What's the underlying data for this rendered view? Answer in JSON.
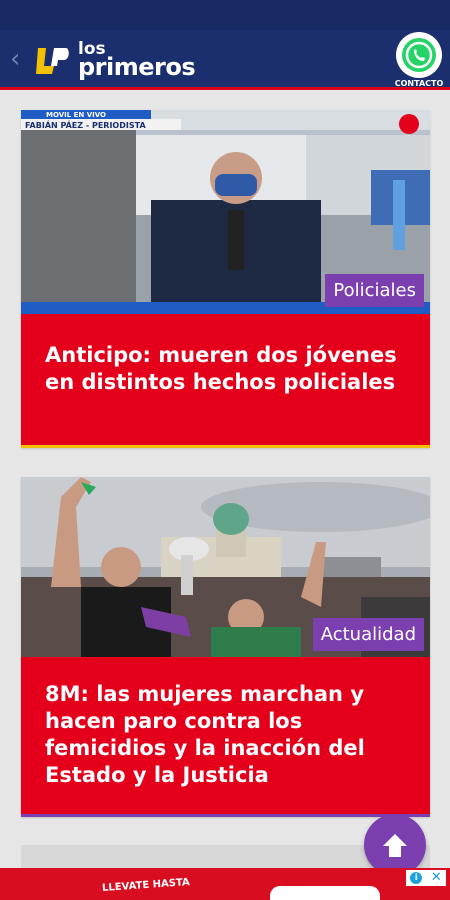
{
  "header": {
    "back_icon": "chevron-left-icon",
    "logo_line1": "los",
    "logo_line2": "primeros",
    "contact_label": "CONTACTO",
    "contact_icon": "whatsapp-icon"
  },
  "articles": [
    {
      "category": "Policiales",
      "title": "Anticipo: mueren dos jóvenes en distintos hechos policiales",
      "image_caption_lines": [
        "MOVIL EN VIVO",
        "FABIÁN PÁEZ - PERIODISTA"
      ]
    },
    {
      "category": "Actualidad",
      "title": "8M: las mujeres marchan y hacen paro contra los femicidios y la inacción del Estado y la Justicia"
    }
  ],
  "scroll_top_icon": "arrow-up-icon",
  "ad": {
    "text": "LLEVATE HASTA",
    "info_icon": "info-icon",
    "close_icon": "close-icon"
  },
  "colors": {
    "header": "#1b2f6e",
    "title_block": "#e4001b",
    "category_tag": "#7b3fb0",
    "accent_yellow": "#f2c200"
  }
}
